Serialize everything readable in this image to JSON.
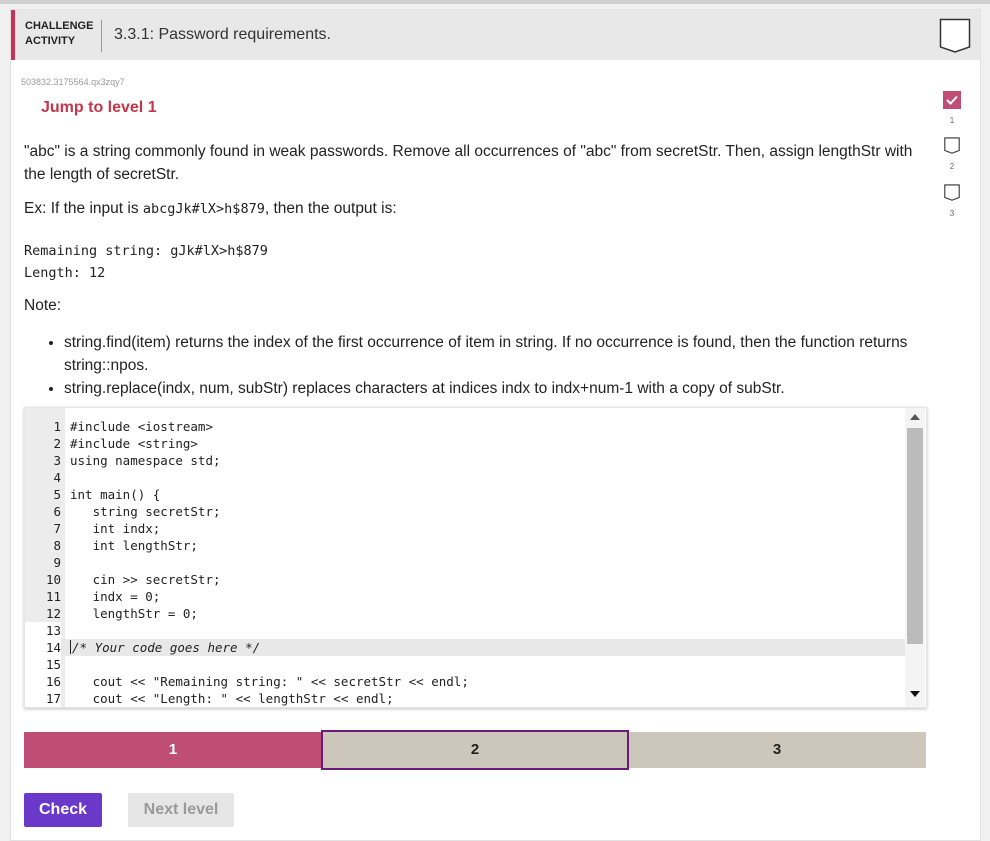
{
  "header": {
    "tag_line1": "CHALLENGE",
    "tag_line2": "ACTIVITY",
    "title": "3.3.1: Password requirements."
  },
  "activity_id": "503832.3175564.qx3zqy7",
  "jump_link": "Jump to level 1",
  "levels": [
    {
      "num": "1",
      "completed": true
    },
    {
      "num": "2",
      "completed": false
    },
    {
      "num": "3",
      "completed": false
    }
  ],
  "instructions": {
    "paragraph1": "\"abc\" is a string commonly found in weak passwords. Remove all occurrences of \"abc\" from secretStr. Then, assign lengthStr with the length of secretStr.",
    "example_prefix": "Ex: If the input is ",
    "example_input": "abcgJk#lX>h$879",
    "example_suffix": ", then the output is:",
    "output_line1": "Remaining string: gJk#lX>h$879",
    "output_line2": "Length: 12",
    "note_label": "Note:",
    "bullet1": "string.find(item) returns the index of the first occurrence of item in string. If no occurrence is found, then the function returns string::npos.",
    "bullet2": "string.replace(indx, num, subStr) replaces characters at indices indx to indx+num-1 with a copy of subStr."
  },
  "code_lines": [
    {
      "n": "1",
      "text": "#include <iostream>"
    },
    {
      "n": "2",
      "text": "#include <string>"
    },
    {
      "n": "3",
      "text": "using namespace std;"
    },
    {
      "n": "4",
      "text": ""
    },
    {
      "n": "5",
      "text": "int main() {"
    },
    {
      "n": "6",
      "text": "   string secretStr;"
    },
    {
      "n": "7",
      "text": "   int indx;"
    },
    {
      "n": "8",
      "text": "   int lengthStr;"
    },
    {
      "n": "9",
      "text": ""
    },
    {
      "n": "10",
      "text": "   cin >> secretStr;"
    },
    {
      "n": "11",
      "text": "   indx = 0;"
    },
    {
      "n": "12",
      "text": "   lengthStr = 0;"
    },
    {
      "n": "13",
      "text": ""
    },
    {
      "n": "14",
      "text": "/* Your code goes here */"
    },
    {
      "n": "15",
      "text": ""
    },
    {
      "n": "16",
      "text": "   cout << \"Remaining string: \" << secretStr << endl;"
    },
    {
      "n": "17",
      "text": "   cout << \"Length: \" << lengthStr << endl;"
    }
  ],
  "progress": {
    "seg1": "1",
    "seg2": "2",
    "seg3": "3"
  },
  "buttons": {
    "check": "Check",
    "next": "Next level"
  },
  "colors": {
    "accent": "#c6325c",
    "jump": "#c2374a",
    "progress_done": "#bf4e74",
    "progress_pending": "#cdc6bb",
    "current_border": "#6a1b7a",
    "check_button": "#6b39c9"
  }
}
